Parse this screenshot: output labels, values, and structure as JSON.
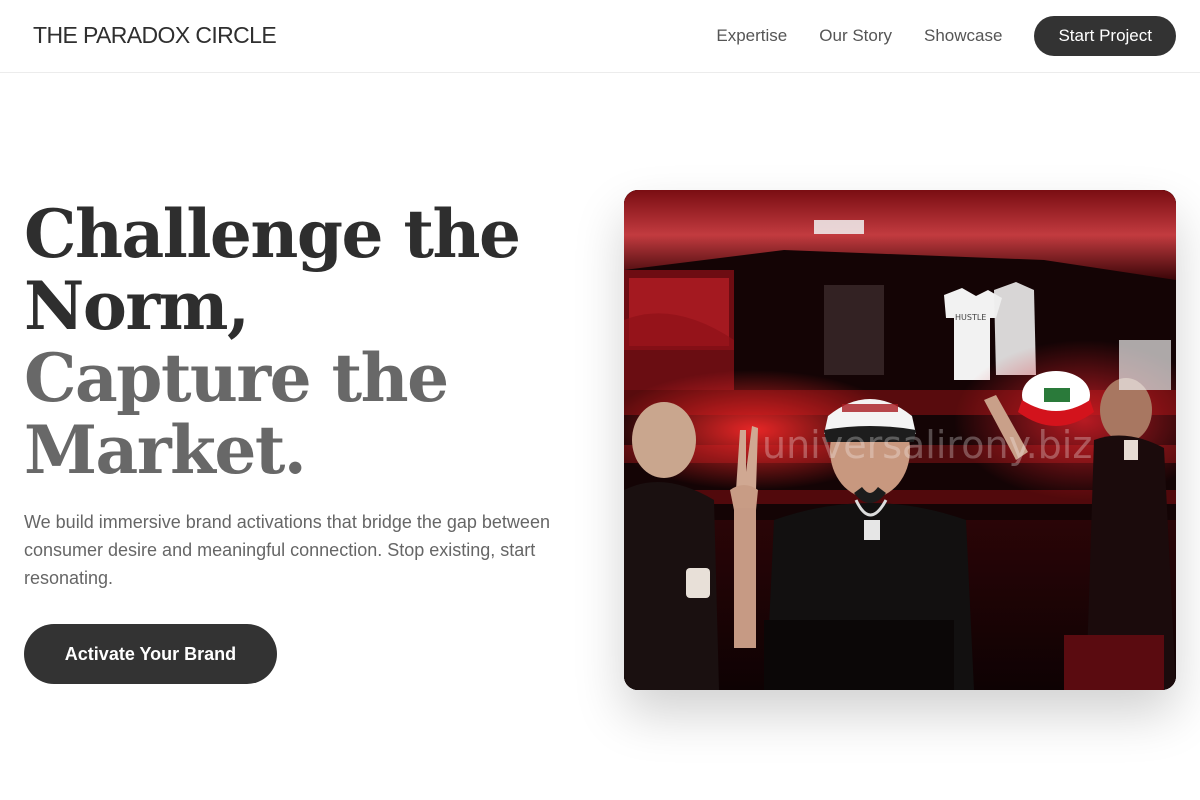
{
  "nav": {
    "brand": "THE PARADOX CIRCLE",
    "links": [
      "Expertise",
      "Our Story",
      "Showcase"
    ],
    "cta": "Start Project"
  },
  "hero": {
    "title_dark": [
      "Challenge the",
      "Norm,"
    ],
    "title_light": [
      "Capture the",
      "Market."
    ],
    "description": "We build immersive brand activations that bridge the gap between consumer desire and meaningful connection. Stop existing, start resonating.",
    "button": "Activate Your Brand"
  },
  "image": {
    "alt": "Party crowd in red-lit venue, man in white cap making peace sign",
    "watermark": "universalirony.biz",
    "tshirt_text": "HUSTLE"
  },
  "colors": {
    "accent": "#333333",
    "title_light": "#686868",
    "body_text": "#666666",
    "image_red": "#d81a1e"
  }
}
